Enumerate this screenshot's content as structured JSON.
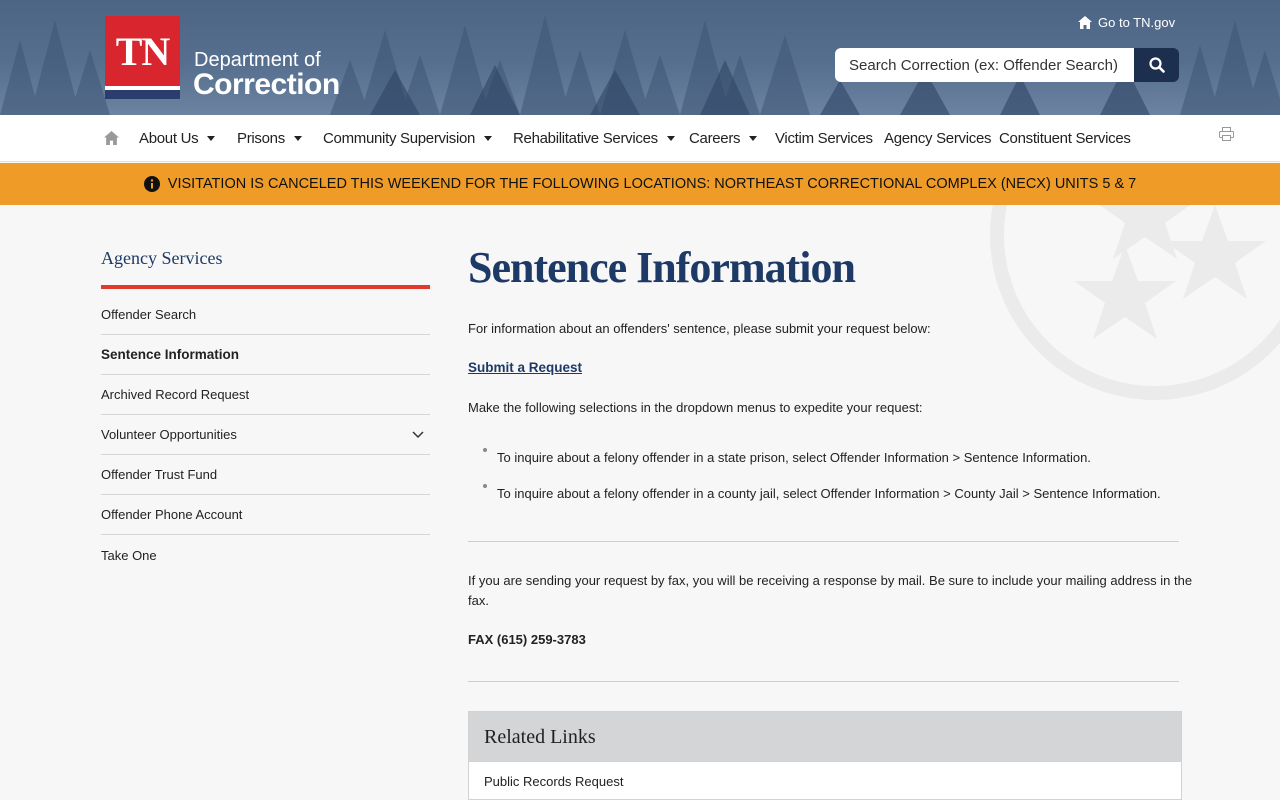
{
  "header": {
    "logo_text": "TN",
    "dept_of": "Department of",
    "dept_name": "Correction",
    "goto_label": "Go to TN.gov",
    "search_placeholder": "Search Correction (ex: Offender Search)"
  },
  "nav": {
    "items": [
      {
        "label": "About Us",
        "has_dropdown": true
      },
      {
        "label": "Prisons",
        "has_dropdown": true
      },
      {
        "label": "Community Supervision",
        "has_dropdown": true
      },
      {
        "label": "Rehabilitative Services",
        "has_dropdown": true
      },
      {
        "label": "Careers",
        "has_dropdown": true
      },
      {
        "label": "Victim Services",
        "has_dropdown": false
      },
      {
        "label": "Agency Services",
        "has_dropdown": false
      },
      {
        "label": "Constituent Services",
        "has_dropdown": false
      }
    ]
  },
  "alert": {
    "text": "VISITATION IS CANCELED THIS WEEKEND FOR THE FOLLOWING LOCATIONS: NORTHEAST CORRECTIONAL COMPLEX (NECX) UNITS 5 & 7"
  },
  "sidebar": {
    "title": "Agency Services",
    "items": [
      {
        "label": "Offender Search"
      },
      {
        "label": "Sentence Information",
        "active": true
      },
      {
        "label": "Archived Record Request"
      },
      {
        "label": "Volunteer Opportunities",
        "expandable": true
      },
      {
        "label": "Offender Trust Fund"
      },
      {
        "label": "Offender Phone Account"
      },
      {
        "label": "Take One"
      }
    ]
  },
  "main": {
    "title": "Sentence Information",
    "intro": "For information about an offenders' sentence, please submit your request below:",
    "request_link": "Submit a Request",
    "selections_text": "Make the following selections in the dropdown menus to expedite your request:",
    "bullets": [
      "To inquire about a felony offender in a state prison, select Offender Information > Sentence Information.",
      "To inquire about a felony offender in a county jail, select Offender Information > County Jail > Sentence Information."
    ],
    "fax_text_line1": "If you are sending your request by fax, you will be receiving a response by mail.  Be sure to include your mailing address in the",
    "fax_text_line2": "fax.",
    "fax_number": "FAX (615) 259-3783"
  },
  "related": {
    "title": "Related Links",
    "links": [
      "Public Records Request"
    ]
  },
  "colors": {
    "header_blue": "#4d6585",
    "navy": "#1d3a66",
    "alert_orange": "#ef9b27",
    "accent_red": "#e03a2d",
    "logo_red": "#d9262e"
  }
}
